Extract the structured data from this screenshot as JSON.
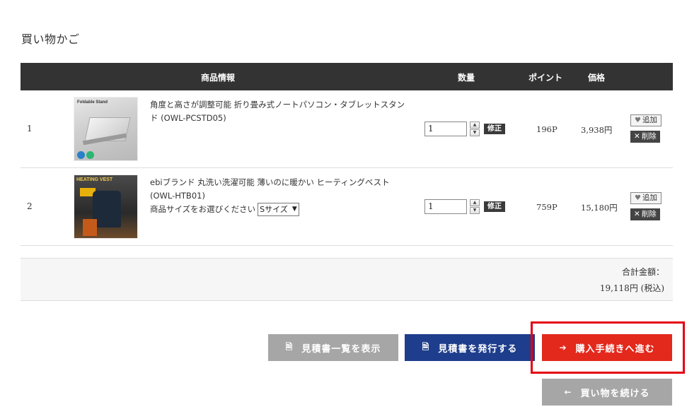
{
  "page_title": "買い物かご",
  "table": {
    "headers": {
      "info": "商品情報",
      "qty": "数量",
      "points": "ポイント",
      "price": "価格"
    },
    "rows": [
      {
        "num": "1",
        "thumb_text": "Foldable Stand",
        "name": "角度と高さが調整可能 折り畳み式ノートパソコン・タブレットスタンド (OWL-PCSTD05)",
        "qty": "1",
        "points": "196P",
        "price": "3,938円"
      },
      {
        "num": "2",
        "thumb_text": "HEATING VEST",
        "name": "ebiブランド 丸洗い洗濯可能 薄いのに暖かい ヒーティングベスト (OWL-HTB01)",
        "size_label": "商品サイズをお選びください",
        "size_value": "Sサイズ",
        "qty": "1",
        "points": "759P",
        "price": "15,180円"
      }
    ],
    "spin_up": "▲",
    "spin_down": "▼",
    "fix_label": "修正",
    "add_label": "追加",
    "delete_label": "削除",
    "add_icon": "♥",
    "delete_icon": "✕"
  },
  "total": {
    "label": "合計金額：",
    "value": "19,118円 (税込)"
  },
  "buttons": {
    "quote_list": "見積書一覧を表示",
    "quote_issue": "見積書を発行する",
    "checkout": "購入手続きへ進む",
    "continue": "買い物を続ける",
    "doc_icon": "🗎",
    "arrow_right": "➔",
    "arrow_left": "←"
  },
  "colors": {
    "header": "#333333",
    "primary": "#1e3d8c",
    "checkout": "#e3281c",
    "secondary": "#a6a6a6",
    "highlight": "#e3000f"
  }
}
